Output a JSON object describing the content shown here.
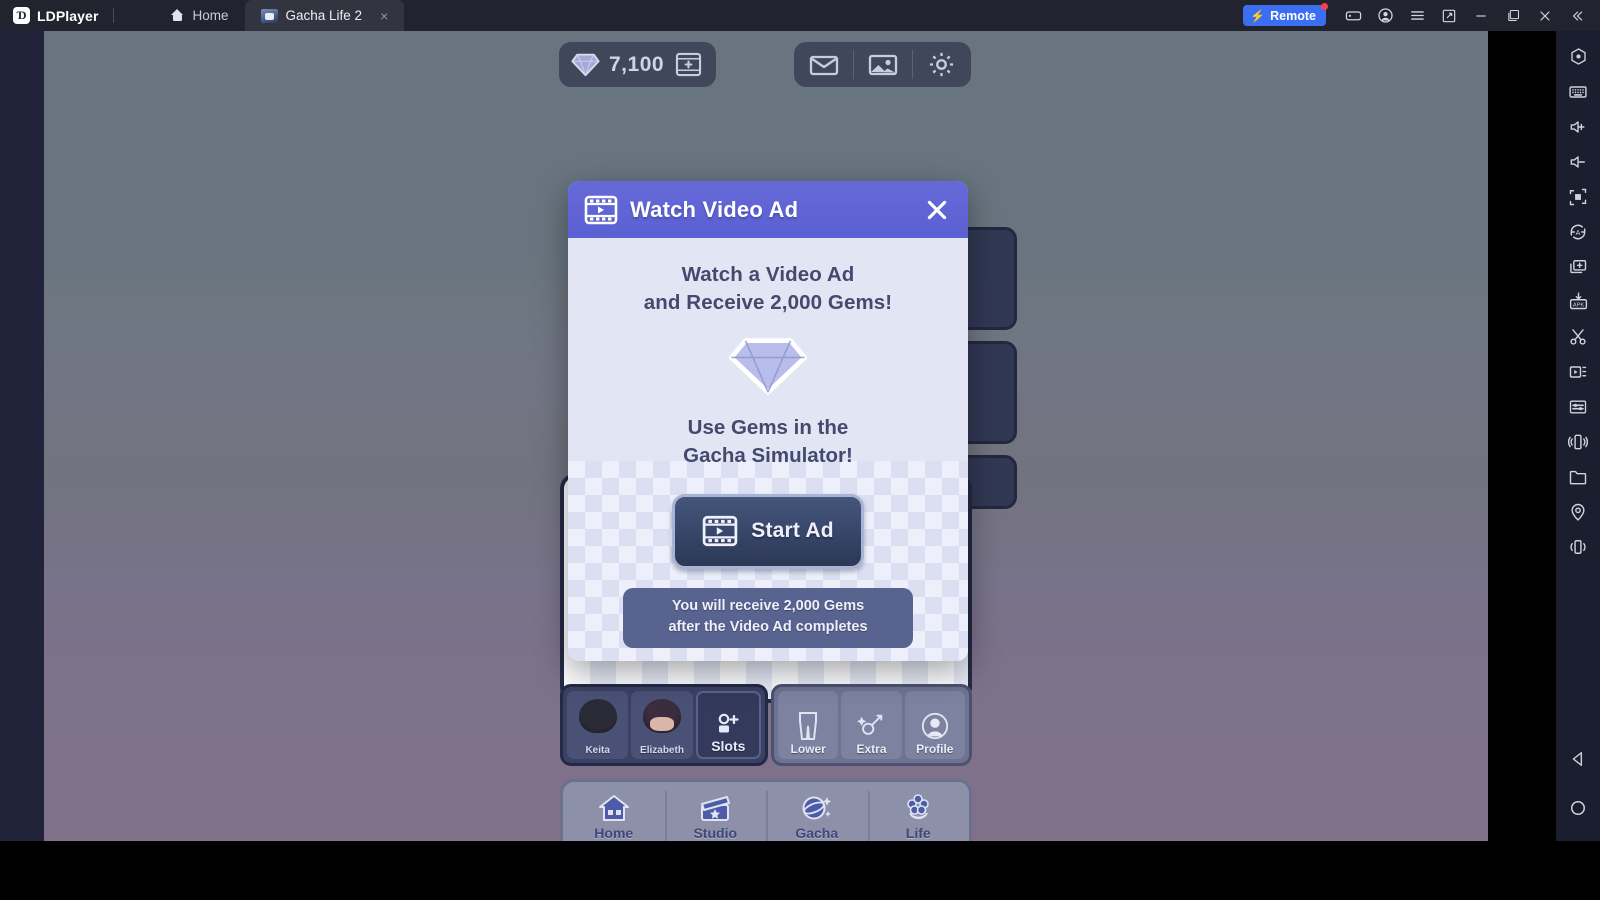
{
  "titlebar": {
    "brand": "LDPlayer",
    "brand_mark": "Ɗ",
    "tabs": [
      {
        "label": "Home",
        "icon": "home-icon",
        "active": false
      },
      {
        "label": "Gacha Life 2",
        "icon": "game-icon",
        "active": true,
        "close": "×"
      }
    ],
    "remote_button": {
      "label": "Remote",
      "icon": "bolt-icon",
      "badge": true,
      "color": "#3b6ef0"
    },
    "controls": [
      {
        "name": "gamepad-icon"
      },
      {
        "name": "account-icon"
      },
      {
        "name": "menu-icon"
      },
      {
        "name": "fullscreen-icon"
      },
      {
        "name": "minimize-icon"
      },
      {
        "name": "maximize-icon"
      },
      {
        "name": "close-icon"
      },
      {
        "name": "collapse-icon"
      }
    ]
  },
  "sidebar": {
    "tools": [
      {
        "name": "record-macro-icon"
      },
      {
        "name": "keyboard-icon"
      },
      {
        "name": "volume-up-icon"
      },
      {
        "name": "volume-down-icon"
      },
      {
        "name": "screenshot-icon"
      },
      {
        "name": "auto-rotate-icon"
      },
      {
        "name": "multi-instance-icon"
      },
      {
        "name": "install-apk-icon"
      },
      {
        "name": "scissors-icon"
      },
      {
        "name": "video-record-icon"
      },
      {
        "name": "operation-settings-icon"
      },
      {
        "name": "shake-icon"
      },
      {
        "name": "file-manager-icon"
      },
      {
        "name": "location-icon"
      },
      {
        "name": "virtual-device-icon"
      }
    ],
    "nav": [
      {
        "name": "android-back-icon"
      },
      {
        "name": "android-home-icon"
      },
      {
        "name": "android-recents-icon"
      }
    ]
  },
  "game": {
    "hud": {
      "gem_count": "7,100",
      "gem_icon": "gem-icon",
      "add_gems_icon": "video-plus-icon",
      "buttons": [
        {
          "name": "mail-icon"
        },
        {
          "name": "gallery-icon"
        },
        {
          "name": "settings-gear-icon"
        }
      ]
    },
    "slots_left": [
      {
        "label": "Keita",
        "type": "character"
      },
      {
        "label": "Elizabeth",
        "type": "character"
      },
      {
        "label": "Slots",
        "type": "add"
      }
    ],
    "slots_right": [
      {
        "label": "Lower",
        "icon": "pants-icon"
      },
      {
        "label": "Extra",
        "icon": "accessory-icon"
      },
      {
        "label": "Profile",
        "icon": "profile-icon"
      }
    ],
    "bottom_nav": [
      {
        "label": "Home",
        "icon": "house-icon"
      },
      {
        "label": "Studio",
        "icon": "clapperboard-icon"
      },
      {
        "label": "Gacha",
        "icon": "orb-star-icon"
      },
      {
        "label": "Life",
        "icon": "flower-icon"
      }
    ]
  },
  "modal": {
    "title": "Watch Video Ad",
    "title_icon": "film-icon",
    "close_label": "×",
    "headline_line1": "Watch a Video Ad",
    "headline_line2": "and Receive 2,000 Gems!",
    "gem_icon": "gem-icon",
    "subline_line1": "Use Gems in the",
    "subline_line2": "Gacha Simulator!",
    "start_button": {
      "label": "Start Ad",
      "icon": "film-icon"
    },
    "note_line1": "You will receive 2,000 Gems",
    "note_line2": "after the Video Ad completes",
    "colors": {
      "header": "#5b60d2",
      "body": "#e2e5f4",
      "button": "#39476b",
      "note": "#59638f",
      "text": "#434a6e"
    }
  }
}
